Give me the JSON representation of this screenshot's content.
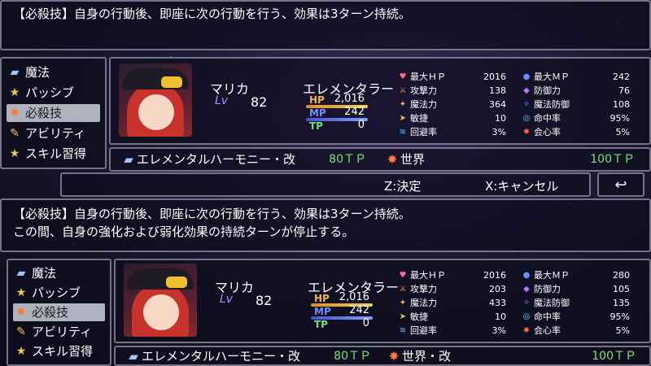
{
  "colors": {
    "hp": "#f0b840",
    "mp": "#6f8cff",
    "tp": "#6fe07a",
    "tp_cost": "#7ee07a",
    "lv": "#a890ff"
  },
  "top": {
    "help_line1": "【必殺技】自身の行動後、即座に次の行動を行う、効果は3ターン持続。",
    "commands": [
      {
        "label": "魔法",
        "icon": "book-icon"
      },
      {
        "label": "パッシブ",
        "icon": "star-icon"
      },
      {
        "label": "必殺技",
        "icon": "fire-icon",
        "selected": true
      },
      {
        "label": "アビリティ",
        "icon": "scroll-icon"
      },
      {
        "label": "スキル習得",
        "icon": "star-icon"
      }
    ],
    "actor": {
      "name": "マリカ",
      "level_label": "Lv",
      "level": "82",
      "class": "エレメンタラー",
      "hp_label": "HP",
      "hp": "2,016",
      "mp_label": "MP",
      "mp": "242",
      "tp_label": "TP",
      "tp": "0"
    },
    "params_left": [
      {
        "label": "最大ＨＰ",
        "value": "2016",
        "icon": "heart-icon"
      },
      {
        "label": "攻撃力",
        "value": "138",
        "icon": "sword-icon"
      },
      {
        "label": "魔法力",
        "value": "364",
        "icon": "wand-icon"
      },
      {
        "label": "敏捷",
        "value": "10",
        "icon": "boot-icon"
      },
      {
        "label": "回避率",
        "value": "3%",
        "icon": "wing-icon"
      }
    ],
    "params_right": [
      {
        "label": "最大ＭＰ",
        "value": "242",
        "icon": "potion-icon"
      },
      {
        "label": "防御力",
        "value": "76",
        "icon": "shield-icon"
      },
      {
        "label": "魔法防御",
        "value": "108",
        "icon": "rune-icon"
      },
      {
        "label": "命中率",
        "value": "95%",
        "icon": "target-icon"
      },
      {
        "label": "会心率",
        "value": "5%",
        "icon": "crit-icon"
      }
    ],
    "skills": [
      {
        "name": "エレメンタルハーモニー・改",
        "cost": "80ＴＰ"
      },
      {
        "name": "世界",
        "cost": "100ＴＰ"
      }
    ]
  },
  "keyhelp": {
    "confirm": "Z:決定",
    "cancel": "X:キャンセル",
    "back_icon": "return-icon"
  },
  "bottom": {
    "help_line1": "【必殺技】自身の行動後、即座に次の行動を行う、効果は3ターン持続。",
    "help_line2": "この間、自身の強化および弱化効果の持続ターンが停止する。",
    "commands": [
      {
        "label": "魔法",
        "icon": "book-icon"
      },
      {
        "label": "パッシブ",
        "icon": "star-icon"
      },
      {
        "label": "必殺技",
        "icon": "fire-icon",
        "selected": true
      },
      {
        "label": "アビリティ",
        "icon": "scroll-icon"
      },
      {
        "label": "スキル習得",
        "icon": "star-icon"
      }
    ],
    "actor": {
      "name": "マリカ",
      "level_label": "Lv",
      "level": "82",
      "class": "エレメンタラー",
      "hp_label": "HP",
      "hp": "2,016",
      "mp_label": "MP",
      "mp": "242",
      "tp_label": "TP",
      "tp": "0"
    },
    "params_left": [
      {
        "label": "最大ＨＰ",
        "value": "2016",
        "icon": "heart-icon"
      },
      {
        "label": "攻撃力",
        "value": "203",
        "icon": "sword-icon"
      },
      {
        "label": "魔法力",
        "value": "433",
        "icon": "wand-icon"
      },
      {
        "label": "敏捷",
        "value": "10",
        "icon": "boot-icon"
      },
      {
        "label": "回避率",
        "value": "3%",
        "icon": "wing-icon"
      }
    ],
    "params_right": [
      {
        "label": "最大ＭＰ",
        "value": "280",
        "icon": "potion-icon"
      },
      {
        "label": "防御力",
        "value": "105",
        "icon": "shield-icon"
      },
      {
        "label": "魔法防御",
        "value": "135",
        "icon": "rune-icon"
      },
      {
        "label": "命中率",
        "value": "95%",
        "icon": "target-icon"
      },
      {
        "label": "会心率",
        "value": "5%",
        "icon": "crit-icon"
      }
    ],
    "skills": [
      {
        "name": "エレメンタルハーモニー・改",
        "cost": "80ＴＰ"
      },
      {
        "name": "世界・改",
        "cost": "100ＴＰ"
      }
    ]
  }
}
